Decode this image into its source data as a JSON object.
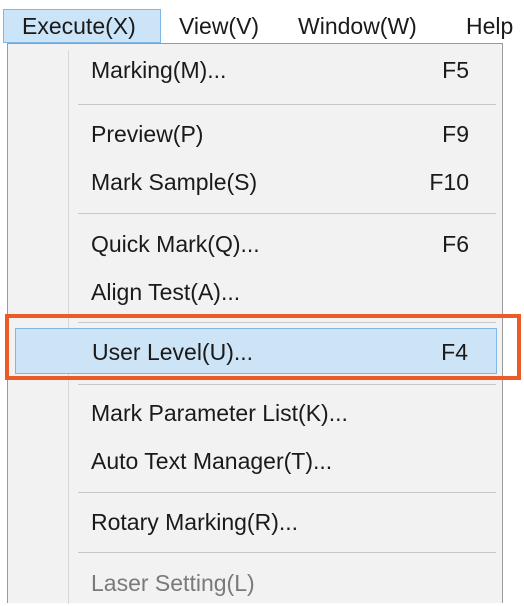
{
  "menubar": {
    "items": [
      {
        "label": "Execute(X)",
        "active": true
      },
      {
        "label": "View(V)",
        "active": false
      },
      {
        "label": "Window(W)",
        "active": false
      },
      {
        "label": "Help",
        "active": false
      }
    ]
  },
  "menu": {
    "items": [
      {
        "label": "Marking(M)...",
        "shortcut": "F5"
      },
      {
        "label": "Preview(P)",
        "shortcut": "F9"
      },
      {
        "label": "Mark Sample(S)",
        "shortcut": "F10"
      },
      {
        "label": "Quick Mark(Q)...",
        "shortcut": "F6"
      },
      {
        "label": "Align Test(A)...",
        "shortcut": ""
      },
      {
        "label": "User Level(U)...",
        "shortcut": "F4",
        "highlighted": true
      },
      {
        "label": "Mark Parameter List(K)...",
        "shortcut": ""
      },
      {
        "label": "Auto Text Manager(T)...",
        "shortcut": ""
      },
      {
        "label": "Rotary Marking(R)...",
        "shortcut": ""
      },
      {
        "label": "Laser Setting(L)",
        "shortcut": "",
        "disabled": true
      }
    ]
  },
  "colors": {
    "highlight": "#cde3f6",
    "highlight_border": "#7fb8e6",
    "callout": "#ec5a2a",
    "menu_background": "#f2f2f2"
  }
}
